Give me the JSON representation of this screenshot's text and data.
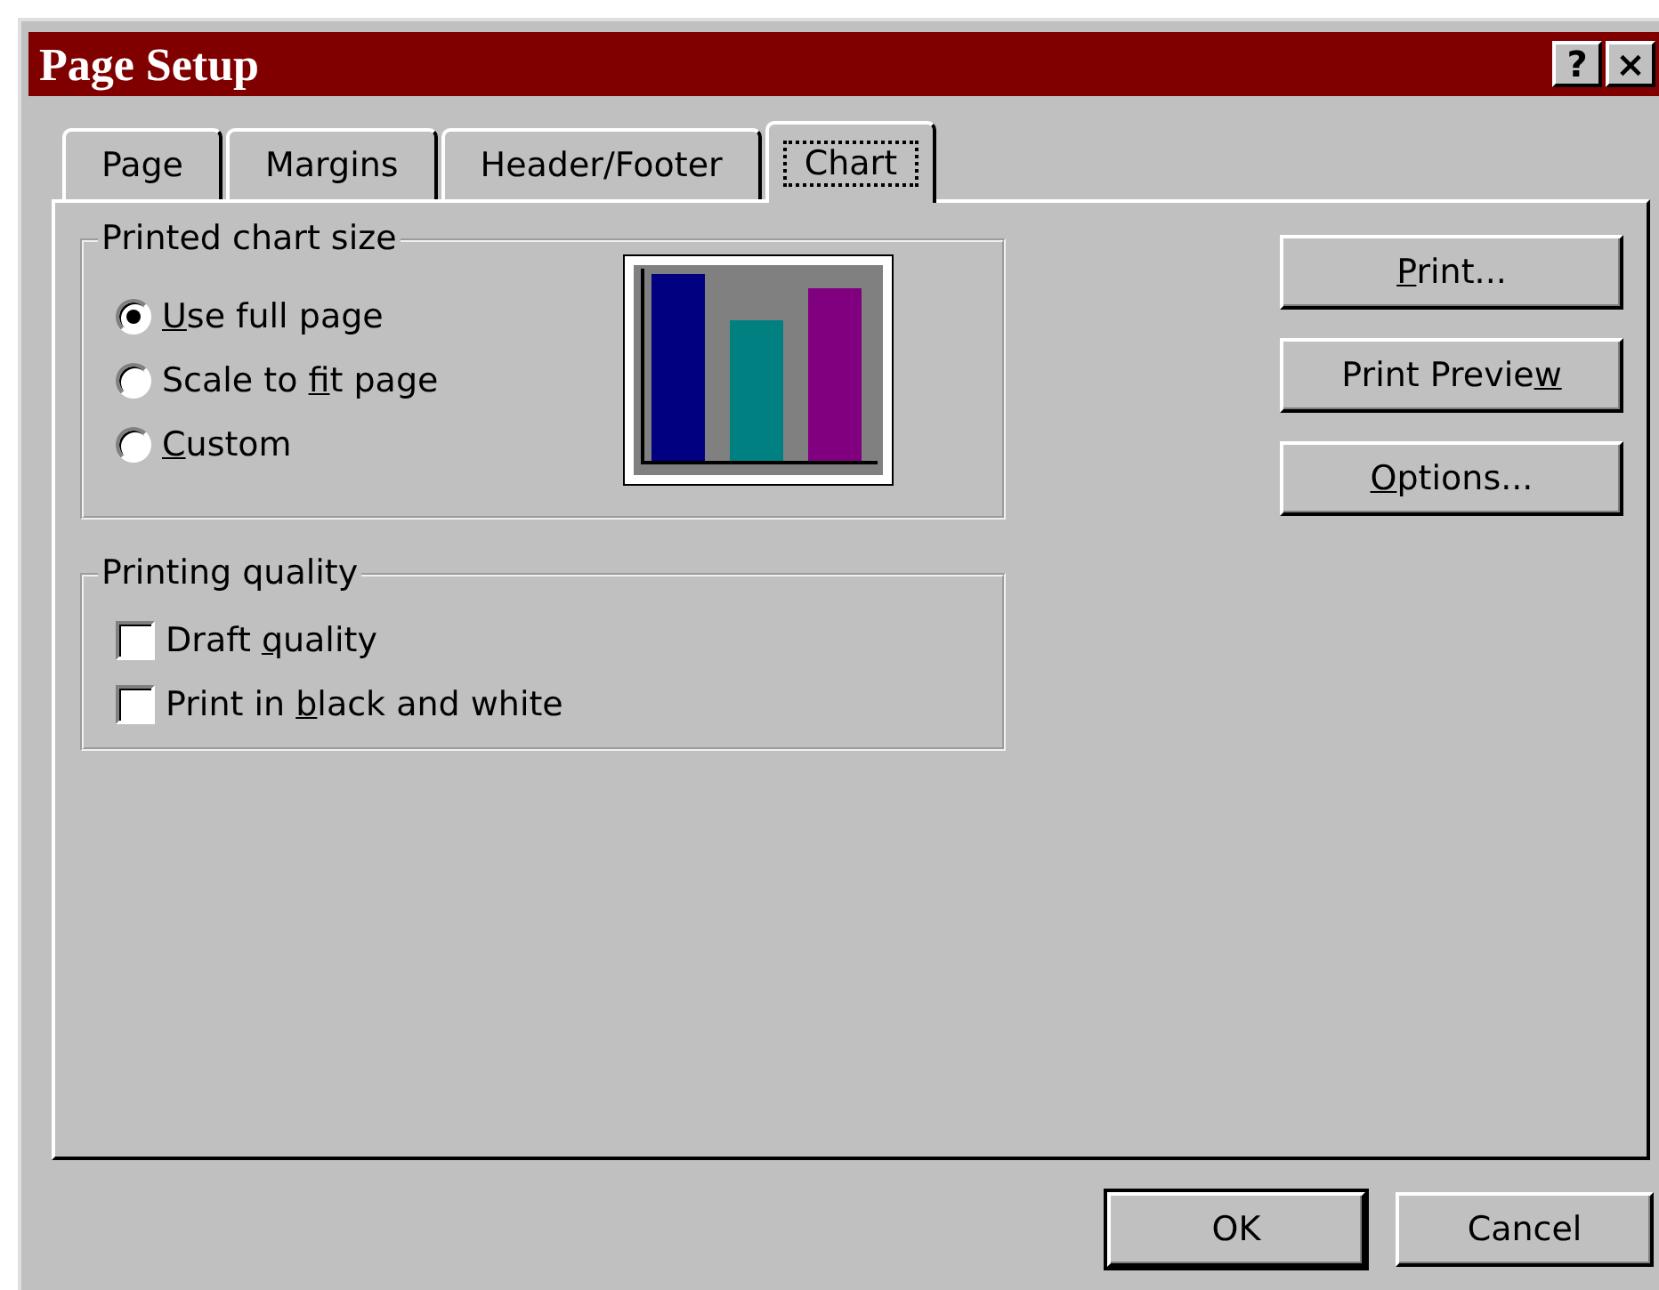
{
  "window": {
    "title": "Page Setup",
    "title_buttons": [
      "?",
      "×"
    ]
  },
  "tabs": [
    {
      "label": "Page",
      "selected": false
    },
    {
      "label": "Margins",
      "selected": false
    },
    {
      "label": "Header/Footer",
      "selected": false
    },
    {
      "label": "Chart",
      "selected": true
    }
  ],
  "chart_size_group": {
    "title": "Printed chart size",
    "options": [
      {
        "parts": [
          {
            "text": "U",
            "underline": true
          },
          {
            "text": "se full page",
            "underline": false
          }
        ],
        "selected": true
      },
      {
        "parts": [
          {
            "text": "Scale to ",
            "underline": false
          },
          {
            "text": "f",
            "underline": true
          },
          {
            "text": "it page",
            "underline": false
          }
        ],
        "selected": false
      },
      {
        "parts": [
          {
            "text": "C",
            "underline": true
          },
          {
            "text": "ustom",
            "underline": false
          }
        ],
        "selected": false
      }
    ]
  },
  "quality_group": {
    "title": "Printing quality",
    "options": [
      {
        "parts": [
          {
            "text": "Draft ",
            "underline": false
          },
          {
            "text": "q",
            "underline": true
          },
          {
            "text": "uality",
            "underline": false
          }
        ],
        "checked": false
      },
      {
        "parts": [
          {
            "text": "Print in ",
            "underline": false
          },
          {
            "text": "b",
            "underline": true
          },
          {
            "text": "lack and white",
            "underline": false
          }
        ],
        "checked": false
      }
    ]
  },
  "side_buttons": [
    {
      "parts": [
        {
          "text": "P",
          "underline": true
        },
        {
          "text": "rint...",
          "underline": false
        }
      ]
    },
    {
      "parts": [
        {
          "text": "Print Previe",
          "underline": false
        },
        {
          "text": "w",
          "underline": true
        }
      ]
    },
    {
      "parts": [
        {
          "text": "O",
          "underline": true
        },
        {
          "text": "ptions...",
          "underline": false
        }
      ]
    }
  ],
  "footer_buttons": [
    {
      "label": "OK",
      "default": true
    },
    {
      "label": "Cancel",
      "default": false
    }
  ]
}
